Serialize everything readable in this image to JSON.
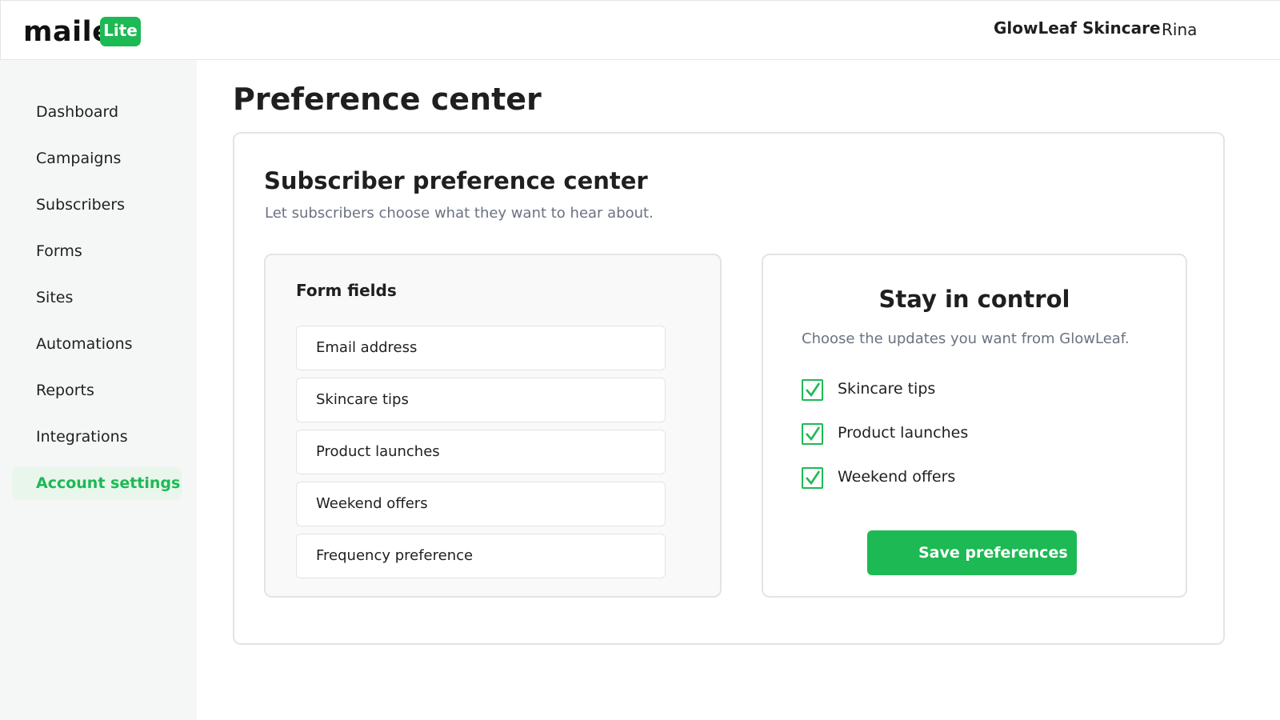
{
  "header": {
    "brand": "maile",
    "badge": "Lite",
    "company": "GlowLeaf Skincare",
    "user": "Rina"
  },
  "sidebar": {
    "items": [
      {
        "label": "Dashboard"
      },
      {
        "label": "Campaigns"
      },
      {
        "label": "Subscribers"
      },
      {
        "label": "Forms"
      },
      {
        "label": "Sites"
      },
      {
        "label": "Automations"
      },
      {
        "label": "Reports"
      },
      {
        "label": "Integrations"
      },
      {
        "label": "Account settings",
        "active": true
      }
    ]
  },
  "page": {
    "title": "Preference center"
  },
  "card": {
    "title": "Subscriber preference center",
    "subtitle": "Let subscribers choose what they want to hear about."
  },
  "form_fields": {
    "title": "Form fields",
    "items": [
      "Email address",
      "Skincare tips",
      "Product launches",
      "Weekend offers",
      "Frequency preference"
    ]
  },
  "preview": {
    "title": "Stay in control",
    "subtitle": "Choose the updates you want from GlowLeaf.",
    "options": [
      {
        "label": "Skincare tips",
        "checked": true
      },
      {
        "label": "Product launches",
        "checked": true
      },
      {
        "label": "Weekend offers",
        "checked": true
      }
    ],
    "save_label": "Save preferences"
  },
  "colors": {
    "accent": "#1db954",
    "active_bg": "#e8f6ec",
    "sidebar_bg": "#f5f7f6",
    "muted_text": "#6b7280"
  }
}
